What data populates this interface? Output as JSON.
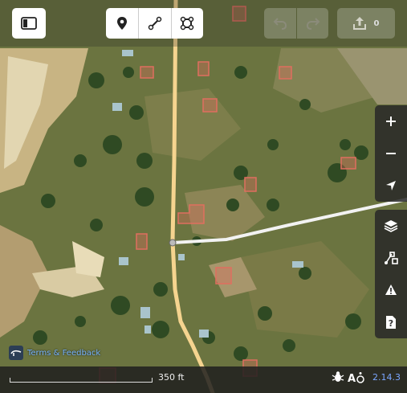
{
  "toolbar": {
    "sidebar_toggle": "sidebar-toggle-icon",
    "modes": [
      "point-icon",
      "line-icon",
      "area-icon"
    ],
    "undo": "undo-icon",
    "redo": "redo-icon",
    "save_icon": "upload-icon",
    "save_count": "0"
  },
  "map_controls": [
    "zoom-in-icon",
    "zoom-out-icon",
    "geolocate-icon"
  ],
  "map_tools": [
    "layers-icon",
    "map-data-icon",
    "issues-icon",
    "help-icon"
  ],
  "terms_label": "Terms & Feedback",
  "scale_label": "350 ft",
  "version": "2.14.3",
  "colors": {
    "road": "#f5d48f",
    "track": "#f2f2f2",
    "building": "#e06e5f",
    "version": "#7aa6ff"
  }
}
